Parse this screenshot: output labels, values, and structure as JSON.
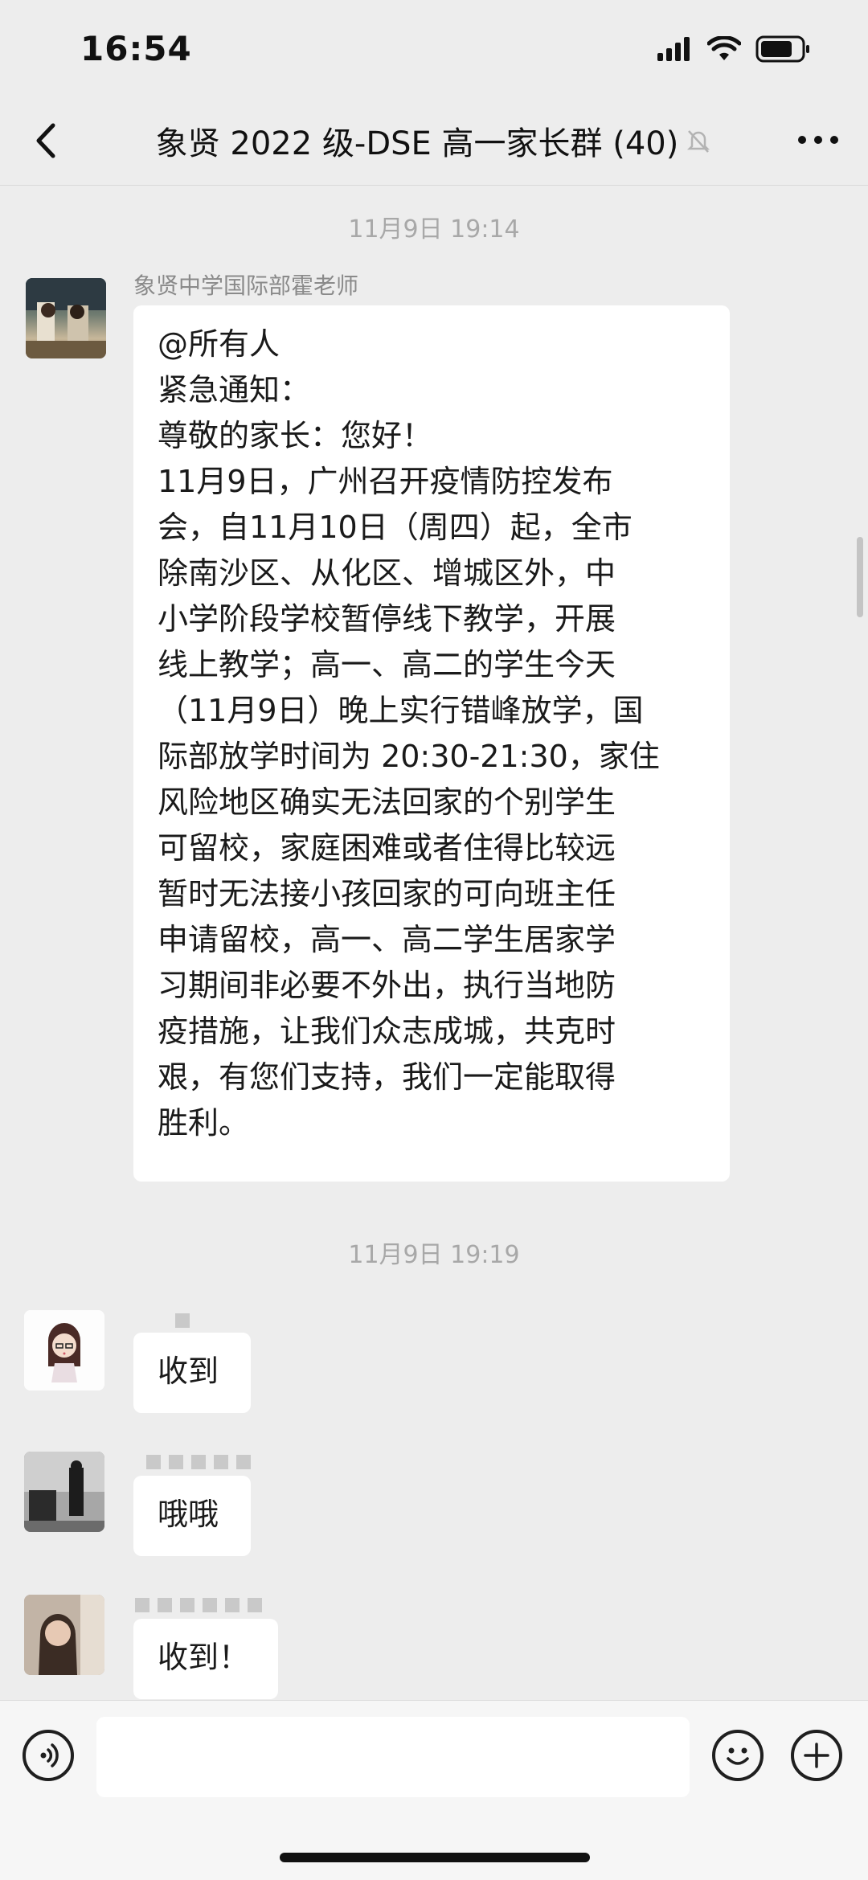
{
  "status_bar": {
    "time": "16:54"
  },
  "nav": {
    "title": "象贤 2022 级-DSE 高一家长群 (40)"
  },
  "chat": {
    "messages_block_1": {
      "timestamp": "11月9日 19:14",
      "sender": "象贤中学国际部霍老师",
      "lines": [
        "@所有人",
        "紧急通知：",
        "尊敬的家长：您好！",
        "11月9日，广州召开疫情防控发布",
        "会，自11月10日（周四）起，全市",
        "除南沙区、从化区、增城区外，中",
        "小学阶段学校暂停线下教学，开展",
        "线上教学；高一、高二的学生今天",
        "（11月9日）晚上实行错峰放学，国",
        "际部放学时间为 20:30-21:30，家住",
        "风险地区确实无法回家的个别学生",
        "可留校，家庭困难或者住得比较远",
        "暂时无法接小孩回家的可向班主任",
        "申请留校，高一、高二学生居家学",
        "习期间非必要不外出，执行当地防",
        "疫措施，让我们众志成城，共克时",
        "艰，有您们支持，我们一定能取得",
        "胜利。"
      ]
    },
    "messages_block_2": {
      "timestamp": "11月9日 19:19",
      "replies": [
        {
          "text": "收到"
        },
        {
          "text": "哦哦"
        },
        {
          "text": "收到！"
        }
      ]
    }
  },
  "icons": {
    "back": "chevron-left-icon",
    "mute": "bell-slash-icon",
    "more": "more-dots-icon",
    "voice": "voice-icon",
    "emoji": "emoji-icon",
    "plus": "plus-icon"
  },
  "colors": {
    "background": "#ededed",
    "bubble": "#ffffff",
    "timestamp": "#a8a8a8"
  }
}
